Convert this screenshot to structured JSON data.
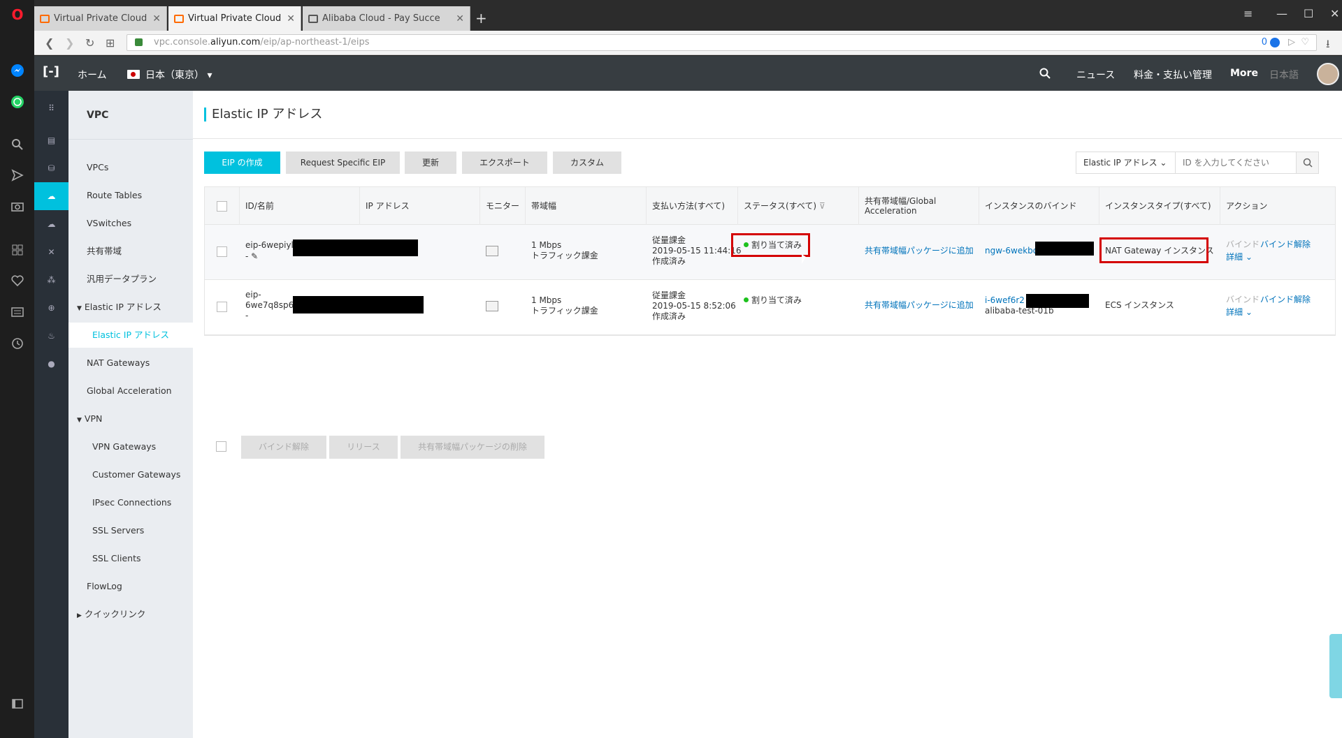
{
  "browser": {
    "tabs": [
      {
        "title": "Virtual Private Cloud",
        "active": false
      },
      {
        "title": "Virtual Private Cloud",
        "active": true
      },
      {
        "title": "Alibaba Cloud - Pay Succe",
        "active": false
      }
    ],
    "url_prefix": "vpc.console.",
    "url_domain": "aliyun.com",
    "url_path": "/eip/ap-northeast-1/eips",
    "badge": "0"
  },
  "topbar": {
    "home": "ホーム",
    "region": "日本（東京）",
    "news": "ニュース",
    "billing": "料金・支払い管理",
    "more": "More",
    "lang": "日本語"
  },
  "sidebar": {
    "title": "VPC",
    "items": [
      {
        "label": "VPCs"
      },
      {
        "label": "Route Tables"
      },
      {
        "label": "VSwitches"
      },
      {
        "label": "共有帯域"
      },
      {
        "label": "汎用データプラン"
      },
      {
        "label": "Elastic IP アドレス"
      },
      {
        "label": "Elastic IP アドレス"
      },
      {
        "label": "NAT Gateways"
      },
      {
        "label": "Global Acceleration"
      },
      {
        "label": "VPN"
      },
      {
        "label": "VPN Gateways"
      },
      {
        "label": "Customer Gateways"
      },
      {
        "label": "IPsec Connections"
      },
      {
        "label": "SSL Servers"
      },
      {
        "label": "SSL Clients"
      },
      {
        "label": "FlowLog"
      },
      {
        "label": "クイックリンク"
      }
    ]
  },
  "page": {
    "title": "Elastic IP アドレス",
    "toolbar": {
      "create": "EIP の作成",
      "request": "Request Specific EIP",
      "refresh": "更新",
      "export": "エクスポート",
      "custom": "カスタム"
    },
    "search": {
      "select": "Elastic IP アドレス",
      "placeholder": "ID を入力してください"
    }
  },
  "table": {
    "headers": {
      "id": "ID/名前",
      "ip": "IP アドレス",
      "monitor": "モニター",
      "bandwidth": "帯域幅",
      "billing": "支払い方法(すべて)",
      "status": "ステータス(すべて)",
      "shared": "共有帯域幅/Global Acceleration",
      "binding": "インスタンスのバインド",
      "itype": "インスタンスタイプ(すべて)",
      "action": "アクション"
    },
    "rows": [
      {
        "id": "eip-6wepiylv",
        "name": "-",
        "bw1": "1 Mbps",
        "bw2": "トラフィック課金",
        "bill1": "従量課金",
        "bill2": "2019-05-15 11:44:16",
        "bill3": "作成済み",
        "status": "割り当て済み",
        "shared": "共有帯域幅パッケージに追加",
        "instance": "ngw-6wekbd9",
        "instance2": "",
        "itype": "NAT Gateway インスタンス",
        "bind": "バインド",
        "unbind": "バインド解除",
        "detail": "詳細"
      },
      {
        "id": "eip-",
        "id2": "6we7q8sp67",
        "name": "-",
        "bw1": "1 Mbps",
        "bw2": "トラフィック課金",
        "bill1": "従量課金",
        "bill2": "2019-05-15 8:52:06",
        "bill3": "作成済み",
        "status": "割り当て済み",
        "shared": "共有帯域幅パッケージに追加",
        "instance": "i-6wef6r2",
        "instance2": "alibaba-test-01b",
        "itype": "ECS インスタンス",
        "bind": "バインド",
        "unbind": "バインド解除",
        "detail": "詳細"
      }
    ]
  },
  "bulk": {
    "unbind": "バインド解除",
    "release": "リリース",
    "remove": "共有帯域幅パッケージの削除"
  }
}
